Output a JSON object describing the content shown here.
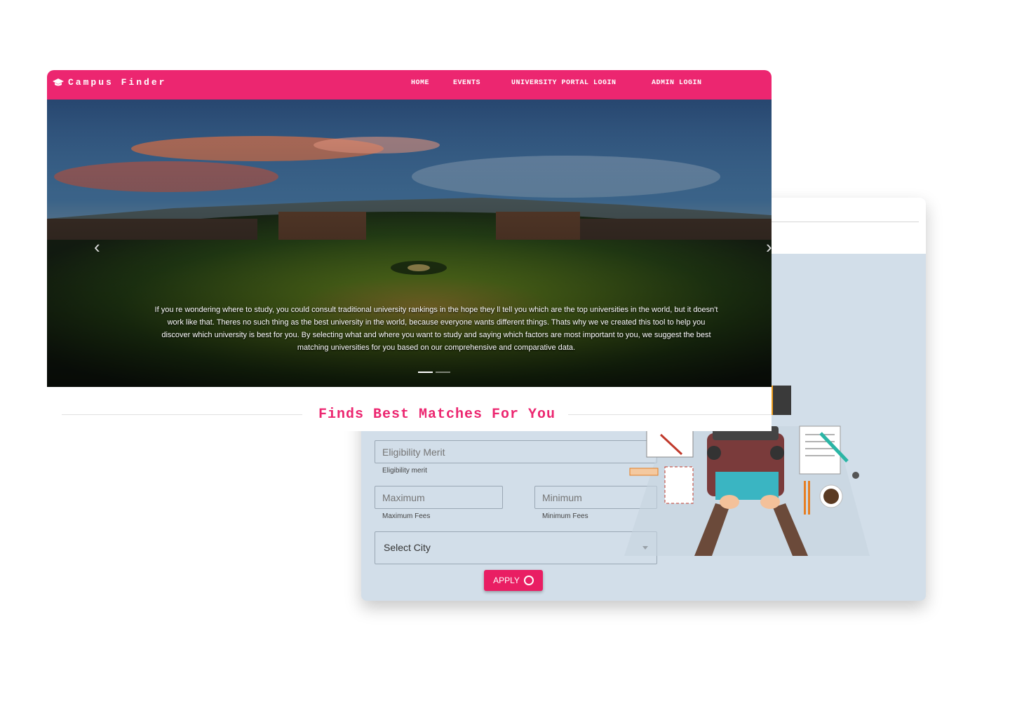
{
  "app": {
    "brand": "Campus Finder"
  },
  "nav": {
    "items": [
      "HOME",
      "EVENTS",
      "UNIVERSITY PORTAL LOGIN",
      "ADMIN LOGIN"
    ]
  },
  "hero": {
    "caption": "If you re wondering where to study, you could consult traditional university rankings in the hope they ll tell you which are the top universities in the world, but it doesn't work like that. Theres no such thing as the best university in the world, because everyone wants different things. Thats why we ve created this tool to help you discover which university is best for you. By selecting what and where you want to study and saying which factors are most important to you, we suggest the best matching universities for you based on our comprehensive and comparative data.",
    "slides": 2,
    "active_slide": 1
  },
  "section": {
    "heading": "Finds Best Matches For You"
  },
  "form": {
    "merit": {
      "placeholder": "Eligibility Merit",
      "helper": "Eligibility merit"
    },
    "max_fees": {
      "placeholder": "Maximum",
      "helper": "Maximum Fees"
    },
    "min_fees": {
      "placeholder": "Minimum",
      "helper": "Minimum Fees"
    },
    "city": {
      "label": "Select City"
    },
    "apply_label": "APPLY"
  },
  "colors": {
    "accent": "#ec2670",
    "form_bg": "#d2dee9"
  }
}
